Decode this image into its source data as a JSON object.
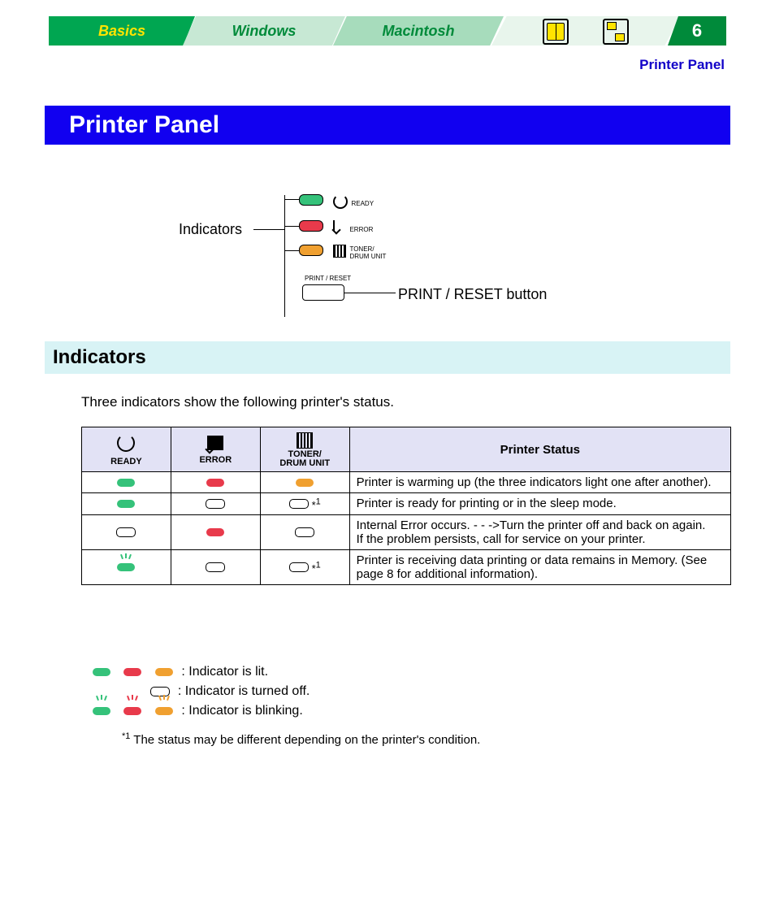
{
  "tabs": {
    "basics": "Basics",
    "windows": "Windows",
    "macintosh": "Macintosh",
    "page_number": "6"
  },
  "breadcrumb": "Printer Panel",
  "title": "Printer Panel",
  "diagram": {
    "indicators_label": "Indicators",
    "print_reset_label": "PRINT / RESET button",
    "ready": "READY",
    "error": "ERROR",
    "toner_drum": "TONER/\nDRUM UNIT",
    "print_reset_small": "PRINT / RESET"
  },
  "section_heading": "Indicators",
  "intro": "Three indicators show the following printer's status.",
  "table": {
    "headers": {
      "ready": "READY",
      "error": "ERROR",
      "toner": "TONER/\nDRUM UNIT",
      "status": "Printer Status"
    },
    "star_note_mark": "*1",
    "rows": [
      {
        "ready": "lit-g",
        "error": "lit-r",
        "toner": "lit-a",
        "toner_note": "",
        "status": "Printer is warming up (the three indicators light one after another)."
      },
      {
        "ready": "lit-g",
        "error": "off",
        "toner": "off",
        "toner_note": "*1",
        "status": "Printer is ready for printing or in the sleep mode."
      },
      {
        "ready": "off",
        "error": "lit-r",
        "toner": "off",
        "toner_note": "",
        "status": "Internal Error occurs. - - ->Turn the printer off and back on again.\nIf the problem persists, call for service on your printer."
      },
      {
        "ready": "blink-g",
        "error": "off",
        "toner": "off",
        "toner_note": "*1",
        "status": "Printer is receiving data printing or data remains in Memory. (See page 8 for additional information)."
      }
    ]
  },
  "legend": {
    "lit": ": Indicator is lit.",
    "off": ": Indicator is turned off.",
    "blink": ": Indicator is blinking."
  },
  "footnote_mark": "*1",
  "footnote": " The status may be different depending on the printer's condition."
}
